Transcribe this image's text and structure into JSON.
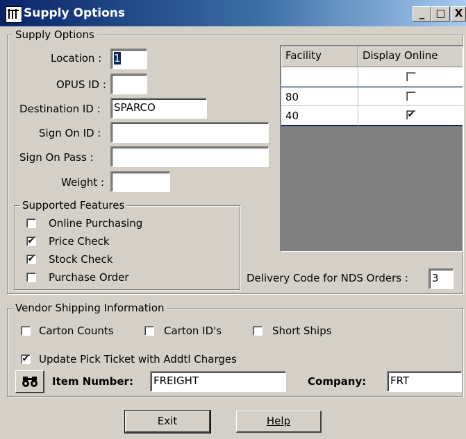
{
  "window": {
    "title": "Supply Options",
    "minimize": "_",
    "maximize": "□",
    "close": "X"
  },
  "supply_options": {
    "legend": "Supply Options",
    "location_label": "Location :",
    "location_value": "1",
    "opus_label": "OPUS ID :",
    "opus_value": "",
    "destination_label": "Destination ID :",
    "destination_value": "SPARCO",
    "signon_label": "Sign On ID :",
    "signon_value": "",
    "signon_pass_label": "Sign On Pass :",
    "signon_pass_value": "",
    "weight_label": "Weight :",
    "weight_value": ""
  },
  "features": {
    "legend": "Supported Features",
    "items": [
      {
        "label": "Online Purchasing",
        "checked": false
      },
      {
        "label": "Price Check",
        "checked": true
      },
      {
        "label": "Stock Check",
        "checked": true
      },
      {
        "label": "Purchase Order",
        "checked": false
      }
    ]
  },
  "facility_grid": {
    "headers": [
      "Facility",
      "Display Online"
    ],
    "rows": [
      {
        "facility": "",
        "display_online": false
      },
      {
        "facility": "80",
        "display_online": false
      },
      {
        "facility": "40",
        "display_online": true
      }
    ]
  },
  "delivery": {
    "label": "Delivery Code for NDS Orders :",
    "value": "3"
  },
  "vendor": {
    "legend": "Vendor Shipping Information",
    "carton_counts": {
      "label": "Carton Counts",
      "checked": false
    },
    "carton_ids": {
      "label": "Carton ID's",
      "checked": false
    },
    "short_ships": {
      "label": "Short Ships",
      "checked": false
    },
    "update_pick": {
      "label": "Update Pick Ticket with Addtl Charges",
      "checked": true
    },
    "item_number_label": "Item Number:",
    "item_number_value": "FREIGHT",
    "company_label": "Company:",
    "company_value": "FRT"
  },
  "buttons": {
    "exit": "Exit",
    "help": "Help"
  },
  "icons": {
    "app": "app-icon",
    "search": "binoculars-icon"
  }
}
